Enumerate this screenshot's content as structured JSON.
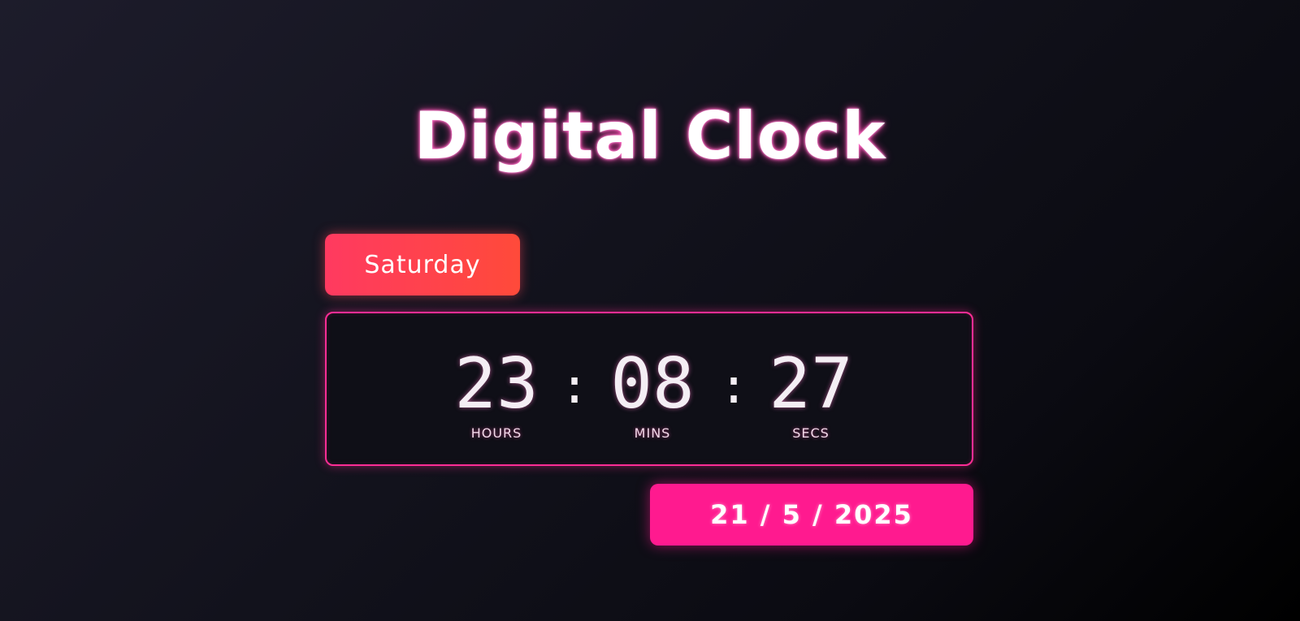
{
  "title": "Digital Clock",
  "day": "Saturday",
  "clock": {
    "hours": "23",
    "minutes": "08",
    "seconds": "27",
    "separator": ":",
    "labels": {
      "hours": "HOURS",
      "minutes": "MINS",
      "seconds": "SECS"
    }
  },
  "date": "21 / 5 / 2025",
  "colors": {
    "accent_pink": "#ff1a8f",
    "day_badge": "#ff4050",
    "panel_border": "#ff2d95",
    "background": "#14141e"
  }
}
